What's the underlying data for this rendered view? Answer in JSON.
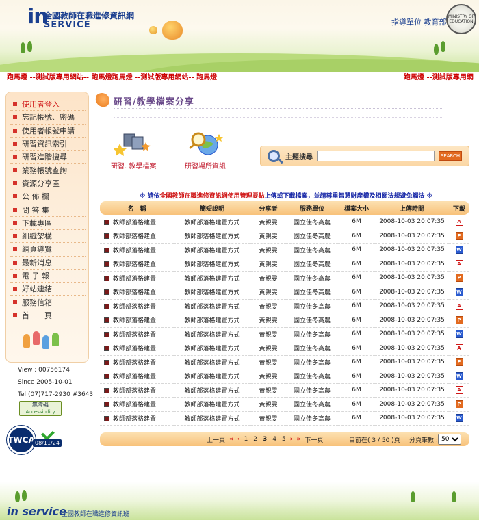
{
  "header": {
    "logo_in": "in",
    "site_title": "全國教師在職進修資訊網",
    "logo_service": "SERVICE",
    "ministry_prefix": "指導單位",
    "ministry_name": "教育部",
    "seal_text": "MINISTRY OF EDUCATION"
  },
  "marquee": {
    "left": "跑馬燈 --測試版專用網站-- 跑馬燈跑馬燈 --測試版專用網站-- 跑馬燈",
    "right": "跑馬燈 --測試版專用網"
  },
  "sidebar": {
    "items": [
      {
        "label": "使用者登入",
        "active": true
      },
      {
        "label": "忘記帳號、密碼"
      },
      {
        "label": "使用者帳號申請"
      },
      {
        "label": "研習資訊索引"
      },
      {
        "label": "研習進階搜尋"
      },
      {
        "label": "業務帳號查詢"
      },
      {
        "label": "資源分享區"
      },
      {
        "label": "公 佈 欄"
      },
      {
        "label": "問 答 集"
      },
      {
        "label": "下載專區"
      },
      {
        "label": "組織架構"
      },
      {
        "label": "網頁導覽"
      },
      {
        "label": "最新消息"
      },
      {
        "label": "電 子 報"
      },
      {
        "label": "好站連結"
      },
      {
        "label": "服務信箱"
      },
      {
        "label": "首　　頁"
      }
    ],
    "view": "View : 00756174",
    "since": "Since 2005-10-01",
    "tel": "Tel:(07)717-2930 #3643",
    "accessibility_zh": "無障礙",
    "accessibility_en": "Accessibility",
    "twca_label": "TWCA",
    "twca_date": "08/11/24"
  },
  "main": {
    "title": "研習/教學檔案分享",
    "shortcut_1": "研習. 教學檔案",
    "shortcut_2": "研習場所資訊",
    "search_label": "主題搜尋",
    "search_value": "",
    "search_button": "SEARCH",
    "notice_prefix": "※ 請依",
    "notice_red": "全國教師在職進修資訊網使用管理要點",
    "notice_suffix": "上傳或下載檔案，並請尊重智慧財產權及相關法規避免觸法 ※",
    "columns": [
      "名　稱",
      "簡短說明",
      "分享者",
      "服務單位",
      "檔案大小",
      "上傳時間",
      "下載"
    ],
    "rows": [
      {
        "name": "教師部落格建置",
        "desc": "教師部落格建置方式",
        "sharer": "黃親雯",
        "unit": "國立佳冬高農",
        "size": "6M",
        "time": "2008-10-03 20:07:35",
        "type": "pdf"
      },
      {
        "name": "教師部落格建置",
        "desc": "教師部落格建置方式",
        "sharer": "黃親雯",
        "unit": "國立佳冬高農",
        "size": "6M",
        "time": "2008-10-03 20:07:35",
        "type": "ppt"
      },
      {
        "name": "教師部落格建置",
        "desc": "教師部落格建置方式",
        "sharer": "黃親雯",
        "unit": "國立佳冬高農",
        "size": "6M",
        "time": "2008-10-03 20:07:35",
        "type": "doc"
      },
      {
        "name": "教師部落格建置",
        "desc": "教師部落格建置方式",
        "sharer": "黃親雯",
        "unit": "國立佳冬高農",
        "size": "6M",
        "time": "2008-10-03 20:07:35",
        "type": "pdf"
      },
      {
        "name": "教師部落格建置",
        "desc": "教師部落格建置方式",
        "sharer": "黃親雯",
        "unit": "國立佳冬高農",
        "size": "6M",
        "time": "2008-10-03 20:07:35",
        "type": "ppt"
      },
      {
        "name": "教師部落格建置",
        "desc": "教師部落格建置方式",
        "sharer": "黃親雯",
        "unit": "國立佳冬高農",
        "size": "6M",
        "time": "2008-10-03 20:07:35",
        "type": "doc"
      },
      {
        "name": "教師部落格建置",
        "desc": "教師部落格建置方式",
        "sharer": "黃親雯",
        "unit": "國立佳冬高農",
        "size": "6M",
        "time": "2008-10-03 20:07:35",
        "type": "pdf"
      },
      {
        "name": "教師部落格建置",
        "desc": "教師部落格建置方式",
        "sharer": "黃親雯",
        "unit": "國立佳冬高農",
        "size": "6M",
        "time": "2008-10-03 20:07:35",
        "type": "ppt"
      },
      {
        "name": "教師部落格建置",
        "desc": "教師部落格建置方式",
        "sharer": "黃親雯",
        "unit": "國立佳冬高農",
        "size": "6M",
        "time": "2008-10-03 20:07:35",
        "type": "doc"
      },
      {
        "name": "教師部落格建置",
        "desc": "教師部落格建置方式",
        "sharer": "黃親雯",
        "unit": "國立佳冬高農",
        "size": "6M",
        "time": "2008-10-03 20:07:35",
        "type": "pdf"
      },
      {
        "name": "教師部落格建置",
        "desc": "教師部落格建置方式",
        "sharer": "黃親雯",
        "unit": "國立佳冬高農",
        "size": "6M",
        "time": "2008-10-03 20:07:35",
        "type": "ppt"
      },
      {
        "name": "教師部落格建置",
        "desc": "教師部落格建置方式",
        "sharer": "黃親雯",
        "unit": "國立佳冬高農",
        "size": "6M",
        "time": "2008-10-03 20:07:35",
        "type": "doc"
      },
      {
        "name": "教師部落格建置",
        "desc": "教師部落格建置方式",
        "sharer": "黃親雯",
        "unit": "國立佳冬高農",
        "size": "6M",
        "time": "2008-10-03 20:07:35",
        "type": "pdf"
      },
      {
        "name": "教師部落格建置",
        "desc": "教師部落格建置方式",
        "sharer": "黃親雯",
        "unit": "國立佳冬高農",
        "size": "6M",
        "time": "2008-10-03 20:07:35",
        "type": "ppt"
      },
      {
        "name": "教師部落格建置",
        "desc": "教師部落格建置方式",
        "sharer": "黃親雯",
        "unit": "國立佳冬高農",
        "size": "6M",
        "time": "2008-10-03 20:07:35",
        "type": "doc"
      }
    ],
    "pager": {
      "prev": "上一頁",
      "first_arrow": "«",
      "prev_arrow": "‹",
      "pages": [
        "1",
        "2",
        "3",
        "4",
        "5"
      ],
      "current": "3",
      "next_arrow": "›",
      "last_arrow": "»",
      "next": "下一頁",
      "info": "目前在( 3 / 50 )頁",
      "per_page_label": "分頁筆數 :",
      "per_page_value": "50"
    }
  },
  "footer": {
    "logo": "in service",
    "subtitle": "全國教師在職進修資訊班"
  },
  "colors": {
    "accent_red": "#d01818",
    "brand_blue": "#1b3f8f",
    "table_header": "#f8c27a"
  }
}
